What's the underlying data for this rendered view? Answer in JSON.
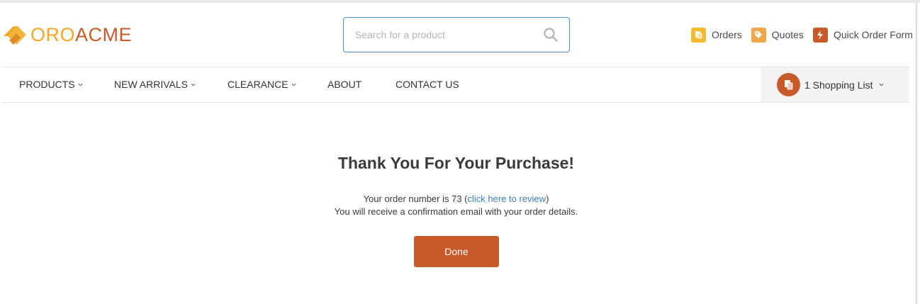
{
  "brand": {
    "logo_left": "ORO",
    "logo_right": "ACME"
  },
  "search": {
    "placeholder": "Search for a product",
    "value": ""
  },
  "header_links": [
    {
      "label": "Orders",
      "icon": "orders-icon",
      "color": "#f5b82e"
    },
    {
      "label": "Quotes",
      "icon": "tag-icon",
      "color": "#f0a64a"
    },
    {
      "label": "Quick Order Form",
      "icon": "lightning-icon",
      "color": "#c85a2a"
    }
  ],
  "nav": {
    "items": [
      {
        "label": "PRODUCTS",
        "has_dropdown": true
      },
      {
        "label": "NEW ARRIVALS",
        "has_dropdown": true
      },
      {
        "label": "CLEARANCE",
        "has_dropdown": true
      },
      {
        "label": "ABOUT",
        "has_dropdown": false
      },
      {
        "label": "CONTACT US",
        "has_dropdown": false
      }
    ],
    "shopping_list": "1 Shopping List"
  },
  "confirmation": {
    "title": "Thank You For Your Purchase!",
    "order_prefix": "Your order number is 73 (",
    "review_link": "click here to review",
    "order_suffix": ")",
    "email_note": "You will receive a confirmation email with your order details.",
    "done_label": "Done"
  },
  "colors": {
    "accent": "#c85a2a",
    "brand_yellow": "#f5a623",
    "link": "#3d7ab8",
    "focus_border": "#4a90c2"
  }
}
